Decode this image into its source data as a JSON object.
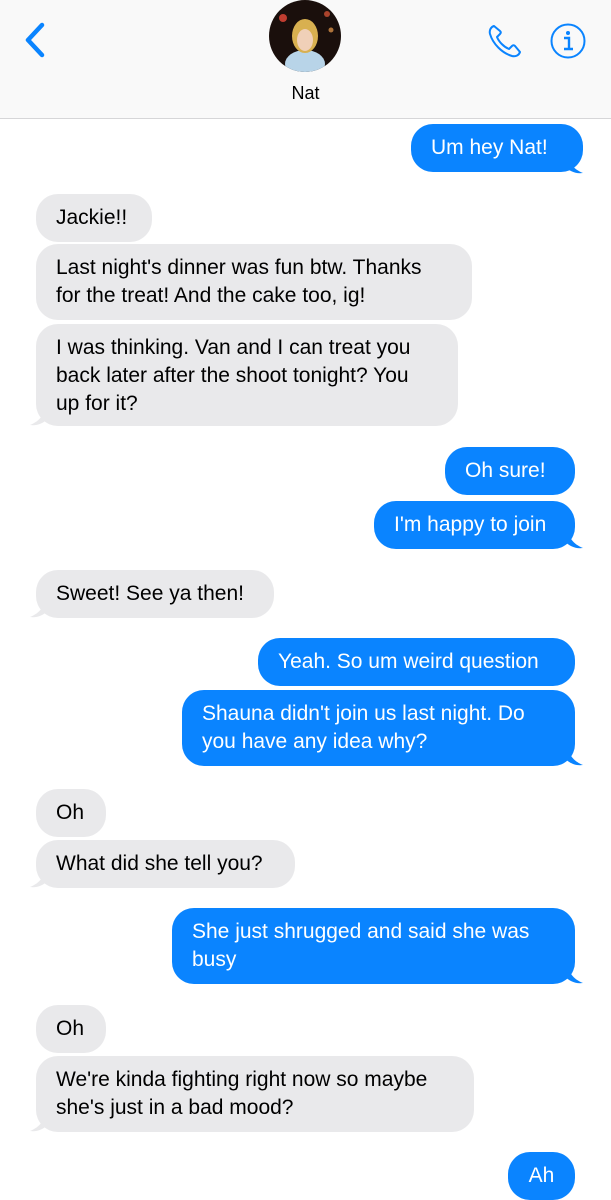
{
  "contact": {
    "name": "Nat"
  },
  "colors": {
    "accent": "#0a84ff",
    "incoming_bg": "#e9e9eb",
    "outgoing_bg": "#0a84ff"
  },
  "icons": {
    "back": "chevron-left-icon",
    "phone": "phone-icon",
    "info": "info-icon"
  },
  "messages": [
    {
      "from": "me",
      "text": "Um hey Nat!"
    },
    {
      "from": "them",
      "text": "Jackie!!"
    },
    {
      "from": "them",
      "text": "Last night's dinner was fun btw. Thanks\nfor the treat! And the cake too, ig!"
    },
    {
      "from": "them",
      "text": "I was thinking. Van and I can treat you\nback later after the shoot tonight? You\nup for it?"
    },
    {
      "from": "me",
      "text": "Oh sure!"
    },
    {
      "from": "me",
      "text": "I'm happy to join"
    },
    {
      "from": "them",
      "text": "Sweet! See ya then!"
    },
    {
      "from": "me",
      "text": "Yeah. So um weird question"
    },
    {
      "from": "me",
      "text": "Shauna didn't join us last night.  Do\nyou have any idea why?"
    },
    {
      "from": "them",
      "text": "Oh"
    },
    {
      "from": "them",
      "text": "What did she tell you?"
    },
    {
      "from": "me",
      "text": "She just shrugged and said she was\nbusy"
    },
    {
      "from": "them",
      "text": "Oh"
    },
    {
      "from": "them",
      "text": "We're kinda fighting right now so maybe\nshe's just in a bad mood?"
    },
    {
      "from": "me",
      "text": "Ah"
    }
  ]
}
